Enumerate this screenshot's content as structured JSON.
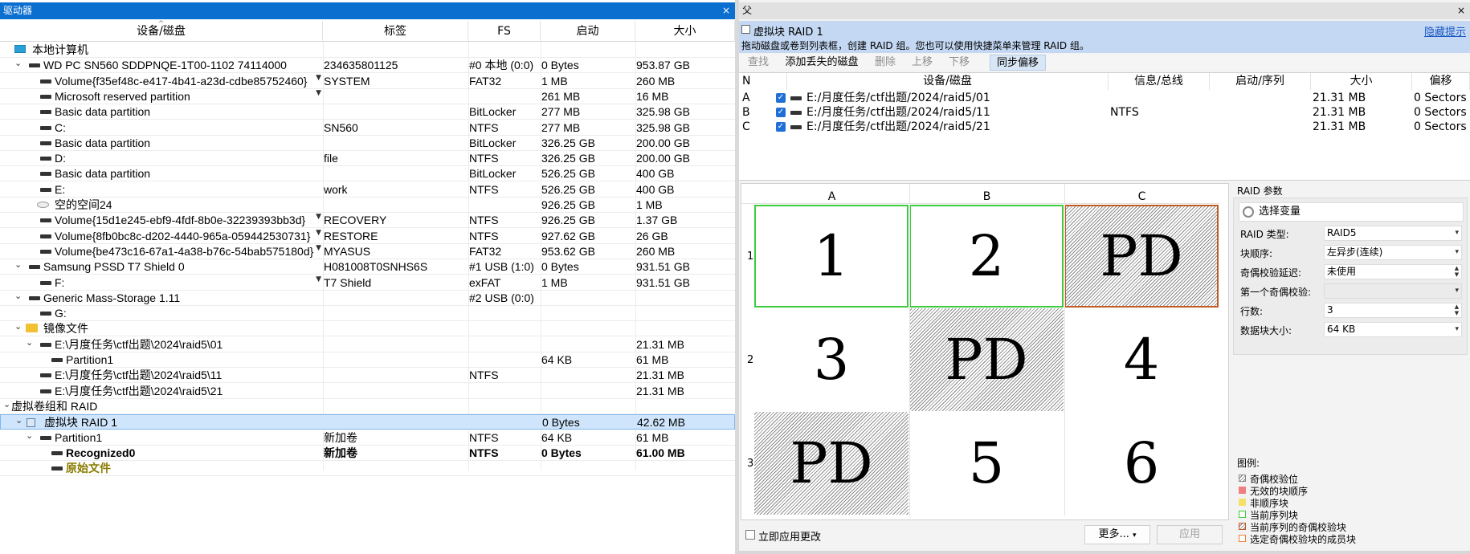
{
  "left_panel": {
    "title": "驱动器",
    "close": "×",
    "columns": {
      "device": "设备/磁盘",
      "label": "标签",
      "fs": "FS",
      "start": "启动",
      "size": "大小"
    },
    "rows": [
      {
        "expander": "",
        "icon": "computer",
        "indent": 0,
        "name": "本地计算机",
        "label": "",
        "fs": "",
        "start": "",
        "size": "",
        "dd": false,
        "style": ""
      },
      {
        "expander": "v",
        "icon": "disk",
        "indent": 1,
        "name": "WD PC SN560 SDDPNQE-1T00-1102 74114000",
        "label": "234635801125",
        "fs": "#0 本地 (0:0)",
        "start": "0 Bytes",
        "size": "953.87 GB",
        "dd": false,
        "style": ""
      },
      {
        "expander": "",
        "icon": "disk",
        "indent": 2,
        "name": "Volume{f35ef48c-e417-4b41-a23d-cdbe85752460}",
        "label": "SYSTEM",
        "fs": "FAT32",
        "start": "1 MB",
        "size": "260 MB",
        "dd": true,
        "style": ""
      },
      {
        "expander": "",
        "icon": "disk",
        "indent": 2,
        "name": "Microsoft reserved partition",
        "label": "",
        "fs": "",
        "start": "261 MB",
        "size": "16 MB",
        "dd": true,
        "style": ""
      },
      {
        "expander": "",
        "icon": "disk",
        "indent": 2,
        "name": "Basic data partition",
        "label": "",
        "fs": "BitLocker",
        "start": "277 MB",
        "size": "325.98 GB",
        "dd": false,
        "style": ""
      },
      {
        "expander": "",
        "icon": "disk",
        "indent": 2,
        "name": "C:",
        "label": "SN560",
        "fs": "NTFS",
        "start": "277 MB",
        "size": "325.98 GB",
        "dd": false,
        "style": ""
      },
      {
        "expander": "",
        "icon": "disk",
        "indent": 2,
        "name": "Basic data partition",
        "label": "",
        "fs": "BitLocker",
        "start": "326.25 GB",
        "size": "200.00 GB",
        "dd": false,
        "style": ""
      },
      {
        "expander": "",
        "icon": "disk",
        "indent": 2,
        "name": "D:",
        "label": "file",
        "fs": "NTFS",
        "start": "326.25 GB",
        "size": "200.00 GB",
        "dd": false,
        "style": ""
      },
      {
        "expander": "",
        "icon": "disk",
        "indent": 2,
        "name": "Basic data partition",
        "label": "",
        "fs": "BitLocker",
        "start": "526.25 GB",
        "size": "400 GB",
        "dd": false,
        "style": ""
      },
      {
        "expander": "",
        "icon": "disk",
        "indent": 2,
        "name": "E:",
        "label": "work",
        "fs": "NTFS",
        "start": "526.25 GB",
        "size": "400 GB",
        "dd": false,
        "style": ""
      },
      {
        "expander": "",
        "icon": "space",
        "indent": 2,
        "name": "空的空间24",
        "label": "",
        "fs": "",
        "start": "926.25 GB",
        "size": "1 MB",
        "dd": false,
        "style": ""
      },
      {
        "expander": "",
        "icon": "disk",
        "indent": 2,
        "name": "Volume{15d1e245-ebf9-4fdf-8b0e-32239393bb3d}",
        "label": "RECOVERY",
        "fs": "NTFS",
        "start": "926.25 GB",
        "size": "1.37 GB",
        "dd": true,
        "style": ""
      },
      {
        "expander": "",
        "icon": "disk",
        "indent": 2,
        "name": "Volume{8fb0bc8c-d202-4440-965a-059442530731}",
        "label": "RESTORE",
        "fs": "NTFS",
        "start": "927.62 GB",
        "size": "26 GB",
        "dd": true,
        "style": ""
      },
      {
        "expander": "",
        "icon": "disk",
        "indent": 2,
        "name": "Volume{be473c16-67a1-4a38-b76c-54bab575180d}",
        "label": "MYASUS",
        "fs": "FAT32",
        "start": "953.62 GB",
        "size": "260 MB",
        "dd": true,
        "style": ""
      },
      {
        "expander": "v",
        "icon": "disk",
        "indent": 1,
        "name": "Samsung PSSD T7 Shield 0",
        "label": "H081008T0SNHS6S",
        "fs": "#1 USB (1:0)",
        "start": "0 Bytes",
        "size": "931.51 GB",
        "dd": false,
        "style": ""
      },
      {
        "expander": "",
        "icon": "disk",
        "indent": 2,
        "name": "F:",
        "label": "T7 Shield",
        "fs": "exFAT",
        "start": "1 MB",
        "size": "931.51 GB",
        "dd": true,
        "style": ""
      },
      {
        "expander": "v",
        "icon": "disk",
        "indent": 1,
        "name": "Generic Mass-Storage 1.11",
        "label": "",
        "fs": "#2 USB (0:0)",
        "start": "",
        "size": "",
        "dd": false,
        "style": ""
      },
      {
        "expander": "",
        "icon": "disk",
        "indent": 2,
        "name": "G:",
        "label": "",
        "fs": "",
        "start": "",
        "size": "",
        "dd": false,
        "style": ""
      },
      {
        "expander": "v",
        "icon": "folder",
        "indent": 1,
        "name": "镜像文件",
        "label": "",
        "fs": "",
        "start": "",
        "size": "",
        "dd": false,
        "style": ""
      },
      {
        "expander": "v",
        "icon": "disk",
        "indent": 2,
        "name": "E:\\月度任务\\ctf出题\\2024\\raid5\\01",
        "label": "",
        "fs": "",
        "start": "",
        "size": "21.31 MB",
        "dd": false,
        "style": ""
      },
      {
        "expander": "",
        "icon": "disk",
        "indent": 3,
        "name": "Partition1",
        "label": "",
        "fs": "",
        "start": "64 KB",
        "size": "61 MB",
        "dd": false,
        "style": ""
      },
      {
        "expander": "",
        "icon": "disk",
        "indent": 2,
        "name": "E:\\月度任务\\ctf出题\\2024\\raid5\\11",
        "label": "",
        "fs": "NTFS",
        "start": "",
        "size": "21.31 MB",
        "dd": false,
        "style": ""
      },
      {
        "expander": "",
        "icon": "disk",
        "indent": 2,
        "name": "E:\\月度任务\\ctf出题\\2024\\raid5\\21",
        "label": "",
        "fs": "",
        "start": "",
        "size": "21.31 MB",
        "dd": false,
        "style": ""
      },
      {
        "expander": "v",
        "icon": "",
        "indent": 0,
        "name": "虚拟卷组和 RAID",
        "label": "",
        "fs": "",
        "start": "",
        "size": "",
        "dd": false,
        "style": ""
      },
      {
        "expander": "v",
        "icon": "raid",
        "indent": 1,
        "name": "虚拟块 RAID 1",
        "label": "",
        "fs": "",
        "start": "0 Bytes",
        "size": "42.62 MB",
        "dd": false,
        "style": "sel"
      },
      {
        "expander": "v",
        "icon": "disk",
        "indent": 2,
        "name": "Partition1",
        "label": "新加卷",
        "fs": "NTFS",
        "start": "64 KB",
        "size": "61 MB",
        "dd": false,
        "style": ""
      },
      {
        "expander": "",
        "icon": "disk",
        "indent": 3,
        "name": "Recognized0",
        "label": "新加卷",
        "fs": "NTFS",
        "start": "0 Bytes",
        "size": "61.00 MB",
        "dd": false,
        "style": "bold"
      },
      {
        "expander": "",
        "icon": "disk",
        "indent": 3,
        "name": "原始文件",
        "label": "",
        "fs": "",
        "start": "",
        "size": "",
        "dd": false,
        "style": "olive"
      }
    ]
  },
  "right_panel": {
    "title": "父",
    "close": "×",
    "header_title": "虚拟块 RAID 1",
    "header_sub": "拖动磁盘或卷到列表框，创建 RAID 组。您也可以使用快捷菜单来管理 RAID 组。",
    "hide_tips": "隐藏提示",
    "toolbar": [
      "查找",
      "添加丢失的磁盘",
      "删除",
      "上移",
      "下移",
      "同步偏移"
    ],
    "toolbar_state": [
      "dis",
      "on",
      "dis",
      "dis",
      "dis",
      "act"
    ],
    "table_headers": [
      "N",
      "设备/磁盘",
      "信息/总线",
      "启动/序列",
      "大小",
      "偏移"
    ],
    "table_rows": [
      {
        "n": "A",
        "device": "E:/月度任务/ctf出题/2024/raid5/01",
        "info": "",
        "start": "",
        "size": "21.31 MB",
        "offset": "0 Sectors"
      },
      {
        "n": "B",
        "device": "E:/月度任务/ctf出题/2024/raid5/11",
        "info": "NTFS",
        "start": "",
        "size": "21.31 MB",
        "offset": "0 Sectors"
      },
      {
        "n": "C",
        "device": "E:/月度任务/ctf出题/2024/raid5/21",
        "info": "",
        "start": "",
        "size": "21.31 MB",
        "offset": "0 Sectors"
      }
    ],
    "grid": {
      "columns": [
        "A",
        "B",
        "C"
      ],
      "rows": [
        "1",
        "2",
        "3"
      ],
      "blocks": [
        [
          "1",
          "2",
          "PD"
        ],
        [
          "3",
          "PD",
          "4"
        ],
        [
          "PD",
          "5",
          "6"
        ]
      ]
    },
    "params": {
      "title": "RAID 参数",
      "select_var": "选择变量",
      "fields": [
        {
          "label": "RAID 类型:",
          "value": "RAID5",
          "kind": "dropdown"
        },
        {
          "label": "块顺序:",
          "value": "左异步(连续)",
          "kind": "dropdown"
        },
        {
          "label": "奇偶校验延迟:",
          "value": "未使用",
          "kind": "spinner"
        },
        {
          "label": "第一个奇偶校验:",
          "value": "",
          "kind": "disabled"
        },
        {
          "label": "行数:",
          "value": "3",
          "kind": "spinner"
        },
        {
          "label": "数据块大小:",
          "value": "64 KB",
          "kind": "dropdown"
        }
      ]
    },
    "legend": {
      "title": "图例:",
      "items": [
        {
          "text": "奇偶校验位",
          "color": "#ffffff"
        },
        {
          "text": "无效的块顺序",
          "color": "#f08080"
        },
        {
          "text": "非顺序块",
          "color": "#f5e06a"
        },
        {
          "text": "当前序列块",
          "color": "#3ccc3c"
        },
        {
          "text": "当前序列的奇偶校验块",
          "color": "#c25a24"
        },
        {
          "text": "选定奇偶校验块的成员块",
          "color": "#f0803a"
        }
      ]
    },
    "bottom": {
      "apply_immediately": "立即应用更改",
      "more": "更多...",
      "apply": "应用"
    }
  }
}
